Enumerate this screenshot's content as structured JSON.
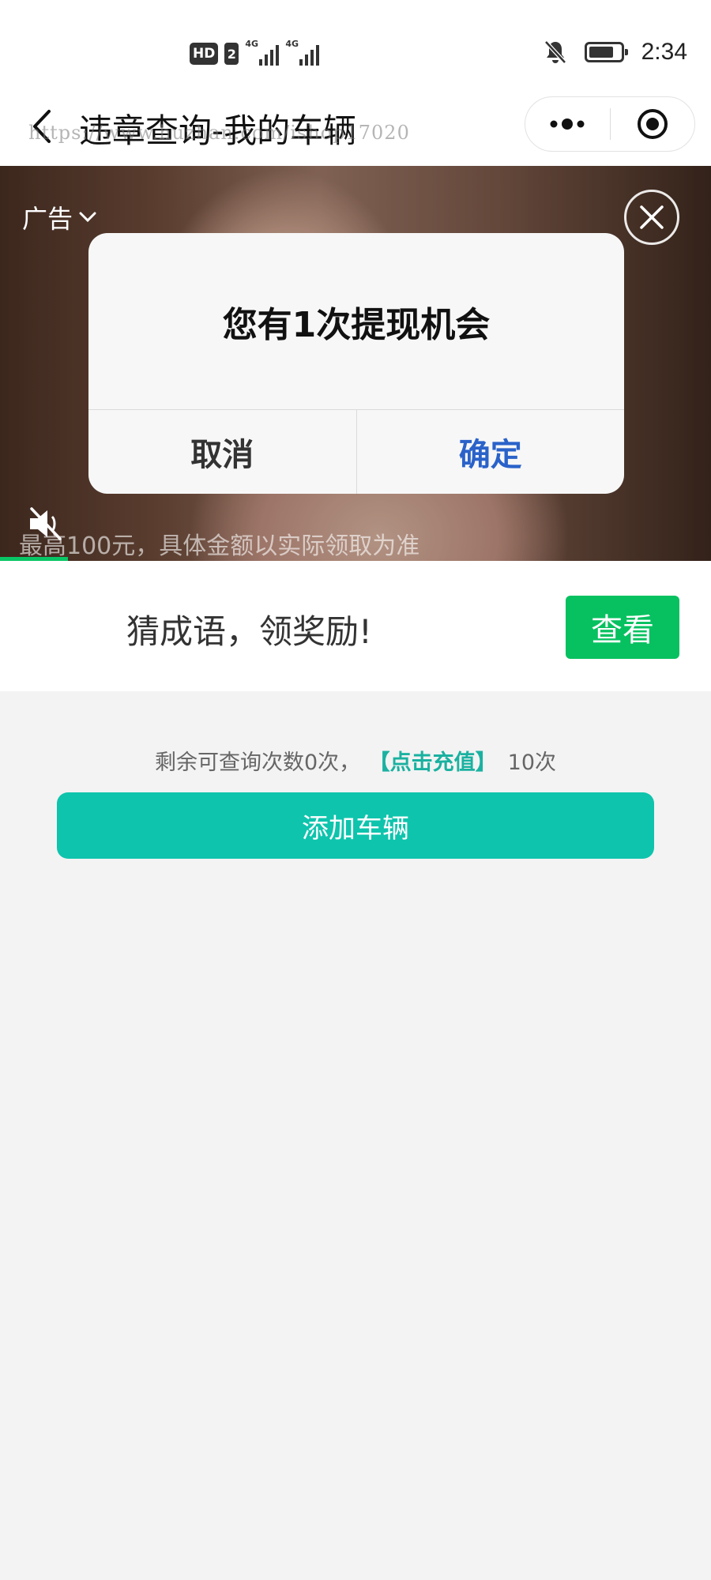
{
  "status_bar": {
    "hd_label": "HD",
    "sim_label": "2",
    "network_1": "4G",
    "network_2": "4G",
    "time": "2:34",
    "icons": [
      "signal-icon",
      "bell-muted-icon",
      "battery-icon"
    ]
  },
  "nav": {
    "title": "违章查询-我的车辆",
    "watermark": "https://www.huzhan.com/ishop17020",
    "icons": [
      "back-arrow-icon",
      "more-dots-icon",
      "target-circle-icon"
    ]
  },
  "ad": {
    "label": "广告",
    "dialog_message": "您有1次提现机会",
    "cancel_label": "取消",
    "confirm_label": "确定",
    "caption": "最高100元，具体金额以实际领取为准",
    "progress": 0.095,
    "icons": [
      "chevron-down-icon",
      "close-icon",
      "mute-icon"
    ]
  },
  "promo": {
    "text": "猜成语，领奖励!",
    "button_label": "查看",
    "accent": "#07c160"
  },
  "query": {
    "remaining_text": "剩余可查询次数0次，",
    "recharge_link": "【点击充值】",
    "count_text": "10次",
    "accent": "#1ab1a0"
  },
  "actions": {
    "add_vehicle_label": "添加车辆",
    "accent": "#0ec4ad"
  }
}
